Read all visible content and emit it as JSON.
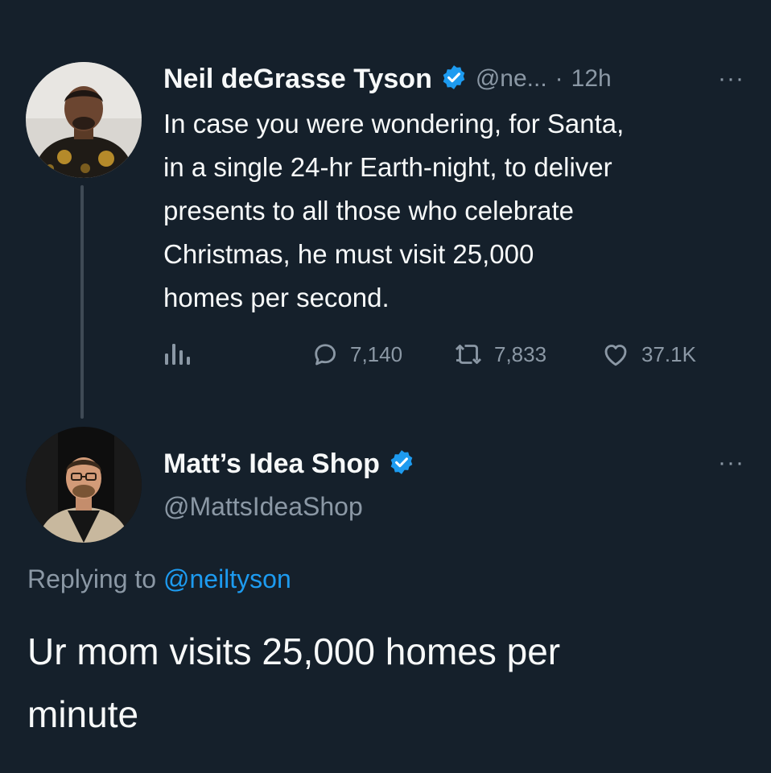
{
  "colors": {
    "background": "#15202b",
    "text": "#f7f9f9",
    "muted": "#8b98a5",
    "accent": "#1d9bf0",
    "verified": "#1d9bf0"
  },
  "tweet": {
    "author_name": "Neil deGrasse Tyson",
    "handle": "@ne...",
    "separator": "·",
    "time": "12h",
    "more_label": "···",
    "lines": [
      "In case you were wondering, for Santa,",
      "in a single 24-hr Earth-night, to deliver",
      "presents to all those who celebrate",
      "Christmas, he must visit 25,000",
      "homes per second."
    ],
    "actions": {
      "analytics_icon": "analytics-icon",
      "replies": "7,140",
      "retweets": "7,833",
      "likes": "37.1K"
    }
  },
  "reply": {
    "author_name": "Matt’s Idea Shop",
    "handle": "@MattsIdeaShop",
    "more_label": "···",
    "replying_prefix": "Replying to",
    "replying_handle": "@neiltyson",
    "lines": [
      "Ur mom visits 25,000 homes per",
      "minute"
    ]
  }
}
